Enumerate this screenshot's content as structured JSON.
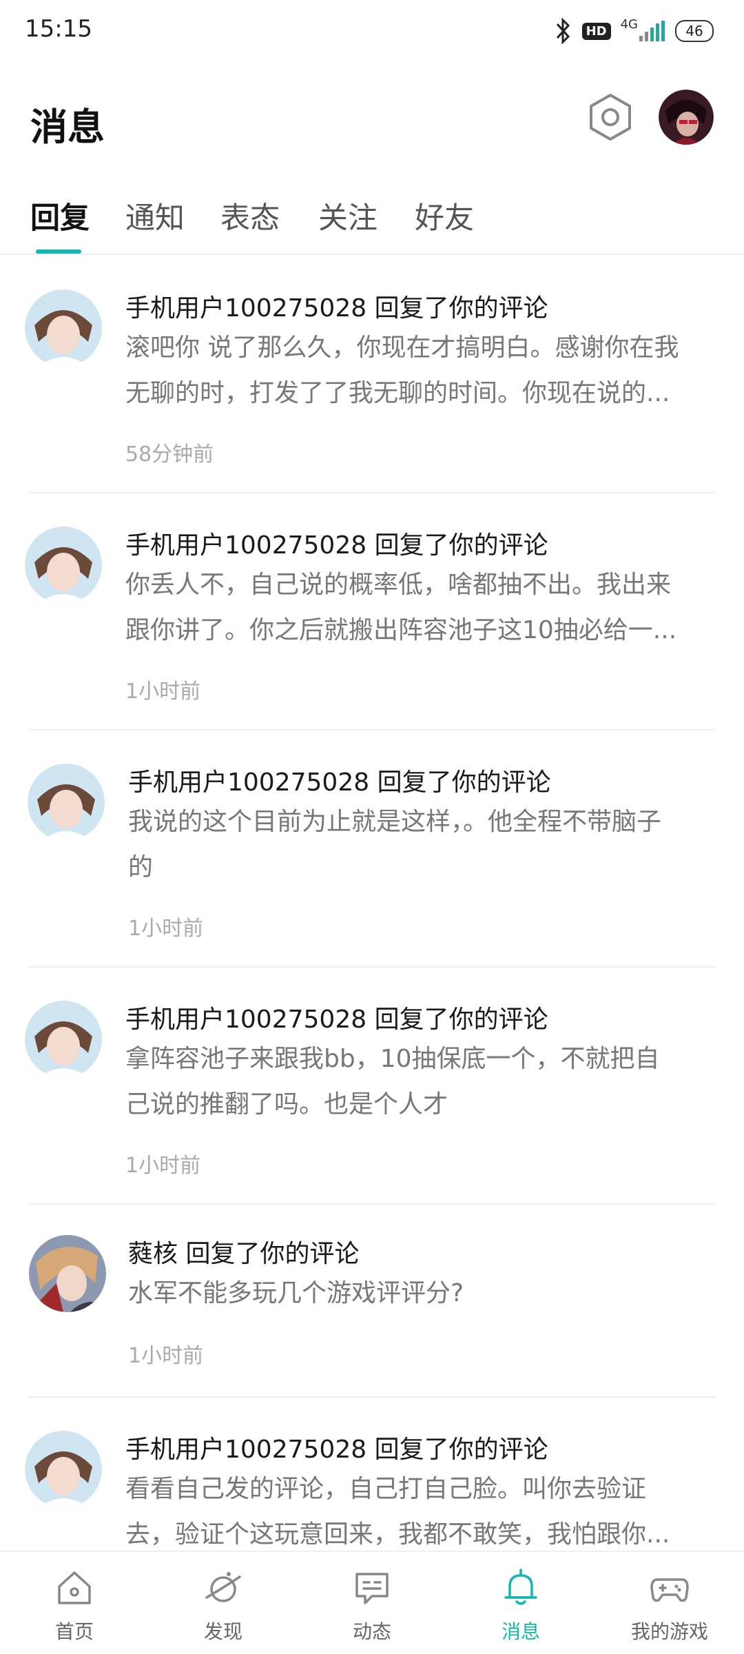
{
  "status_bar": {
    "time": "15:15",
    "network": "4G",
    "hd": "HD",
    "battery": "46"
  },
  "header": {
    "title": "消息"
  },
  "tabs": [
    {
      "label": "回复",
      "active": true
    },
    {
      "label": "通知",
      "active": false
    },
    {
      "label": "表态",
      "active": false
    },
    {
      "label": "关注",
      "active": false
    },
    {
      "label": "好友",
      "active": false
    }
  ],
  "messages": [
    {
      "title": "手机用户100275028 回复了你的评论",
      "body_lines": [
        "滚吧你 说了那么久，你现在才搞明白。感谢你在我",
        "无聊的时，打发了了我无聊的时间。你现在说的..."
      ],
      "time": "58分钟前"
    },
    {
      "title": "手机用户100275028 回复了你的评论",
      "body_lines": [
        "你丢人不，自己说的概率低，啥都抽不出。我出来",
        "跟你讲了。你之后就搬出阵容池子这10抽必给一..."
      ],
      "time": "1小时前"
    },
    {
      "title": "手机用户100275028 回复了你的评论",
      "body_lines": [
        "我说的这个目前为止就是这样，。他全程不带脑子",
        "的"
      ],
      "time": "1小时前"
    },
    {
      "title": "手机用户100275028 回复了你的评论",
      "body_lines": [
        "拿阵容池子来跟我bb，10抽保底一个，不就把自",
        "己说的推翻了吗。也是个人才"
      ],
      "time": "1小时前"
    },
    {
      "title": "蕤核 回复了你的评论",
      "body_lines": [
        "水军不能多玩几个游戏评评分?"
      ],
      "time": "1小时前"
    },
    {
      "title": "手机用户100275028 回复了你的评论",
      "body_lines": [
        "看看自己发的评论，自己打自己脸。叫你去验证",
        "去，验证个这玩意回来，我都不敢笑，我怕跟你..."
      ],
      "time": ""
    }
  ],
  "bottom_nav": [
    {
      "label": "首页",
      "icon": "home-icon",
      "active": false
    },
    {
      "label": "发现",
      "icon": "discover-icon",
      "active": false
    },
    {
      "label": "动态",
      "icon": "feed-icon",
      "active": false
    },
    {
      "label": "消息",
      "icon": "bell-icon",
      "active": true
    },
    {
      "label": "我的游戏",
      "icon": "gamepad-icon",
      "active": false
    }
  ],
  "colors": {
    "accent": "#14b5b0",
    "text_primary": "#1a1a1a",
    "text_secondary": "#777777",
    "text_muted": "#aaaaaa"
  }
}
